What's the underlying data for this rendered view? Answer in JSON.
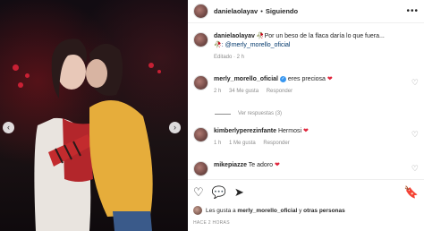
{
  "post": {
    "username": "danielaolayav",
    "separator": "•",
    "follow_status": "Siguiendo",
    "more_icon": "more-horizontal-icon"
  },
  "caption": {
    "username": "danielaolayav",
    "text": "🥀Por un beso de la flaca daría lo que fuera...",
    "mention_line": "🥀: @merly_morello_oficial",
    "meta": "Editado · 2 h"
  },
  "comments": [
    {
      "username": "merly_morello_oficial",
      "verified": true,
      "text": "eres preciosa",
      "heart": "❤",
      "time": "2 h",
      "likes": "34 Me gusta",
      "reply": "Responder"
    },
    {
      "username": "kimberlyperezinfante",
      "text": "Hermosi",
      "heart": "❤",
      "time": "1 h",
      "likes": "1 Me gusta",
      "reply": "Responder"
    },
    {
      "username": "mikepiazze",
      "text": "Te adoro",
      "heart": "❤"
    }
  ],
  "view_replies": "Ver respuestas (3)",
  "actions": {
    "like_icon": "heart-outline-icon",
    "comment_icon": "comment-icon",
    "share_icon": "share-icon",
    "save_icon": "bookmark-icon"
  },
  "likes": {
    "prefix": "Les gusta a",
    "user": "merly_morello_oficial",
    "and": "y",
    "others": "otras personas"
  },
  "time_ago": "HACE 2 HORAS",
  "nav": {
    "prev": "‹",
    "next": "›"
  },
  "colors": {
    "heart": "#e0233a",
    "link": "#00376b",
    "muted": "#8e8e8e",
    "verified": "#3897f0"
  }
}
